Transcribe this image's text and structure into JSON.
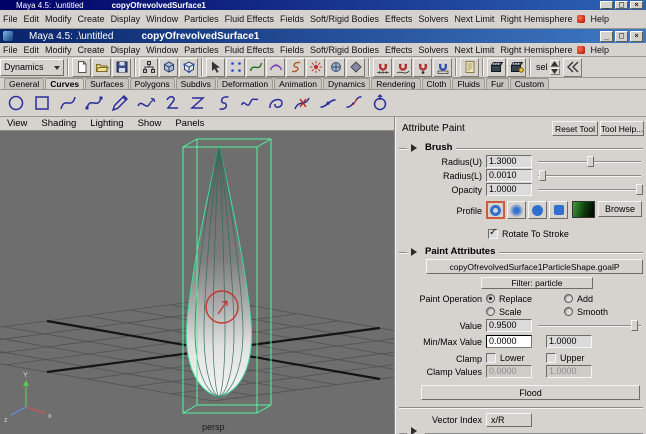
{
  "window": {
    "title": "Maya 4.5: .\\untitled",
    "document": "copyOfrevolvedSurface1"
  },
  "glyphs": {
    "minimize": "_",
    "maximize": "□",
    "close": "×",
    "check": "✓"
  },
  "menus": [
    "File",
    "Edit",
    "Modify",
    "Create",
    "Display",
    "Window",
    "Particles",
    "Fluid Effects",
    "Fields",
    "Soft/Rigid Bodies",
    "Effects",
    "Solvers",
    "Next Limit",
    "Right Hemisphere",
    "Help"
  ],
  "statusline": {
    "menu_set": "Dynamics",
    "quick_select": "sel",
    "icons": [
      "file-new-icon",
      "file-open-icon",
      "file-save-icon",
      "select-hierarchy-icon",
      "select-object-icon",
      "select-component-icon",
      "mask-handles-icon",
      "mask-points-icon",
      "mask-curves-icon",
      "mask-surfaces-icon",
      "mask-deformations-icon",
      "mask-dynamics-icon",
      "mask-rendering-icon",
      "mask-misc-icon",
      "snap-grid-icon",
      "snap-curve-icon",
      "snap-point-icon",
      "snap-plane-icon",
      "history-icon",
      "render-frame-icon",
      "ipr-render-icon",
      "ui-collapse-icon"
    ]
  },
  "shelf": {
    "tabs": [
      "General",
      "Curves",
      "Surfaces",
      "Polygons",
      "Subdivs",
      "Deformation",
      "Animation",
      "Dynamics",
      "Rendering",
      "Cloth",
      "Fluids",
      "Fur",
      "Custom"
    ],
    "active_tab": "Curves",
    "icons": [
      "circle-tool-icon",
      "square-tool-icon",
      "cv-curve-icon",
      "ep-curve-icon",
      "pencil-curve-icon",
      "add-points-icon",
      "curve-fillet-icon",
      "z-curve-icon",
      "s-curve-icon",
      "sine-curve-icon",
      "spiral-curve-icon",
      "cut-curve-icon",
      "attach-curve-icon",
      "detach-curve-icon",
      "close-curve-icon"
    ]
  },
  "panel_menu": [
    "View",
    "Shading",
    "Lighting",
    "Show",
    "Panels"
  ],
  "viewport": {
    "camera": "persp",
    "axis_x": "x",
    "axis_y": "Y",
    "axis_z": "z"
  },
  "tool": {
    "title": "Attribute Paint",
    "reset": "Reset Tool",
    "help": "Tool Help...",
    "brush": {
      "header": "Brush",
      "radius_u_label": "Radius(U)",
      "radius_u": "1.3000",
      "radius_l_label": "Radius(L)",
      "radius_l": "0.0010",
      "opacity_label": "Opacity",
      "opacity": "1.0000",
      "profile_label": "Profile",
      "browse": "Browse",
      "rotate": "Rotate To Stroke"
    },
    "paint": {
      "header": "Paint Attributes",
      "attribute": "copyOfrevolvedSurface1ParticleShape.goalP",
      "filter": "Filter: particle",
      "operation_label": "Paint Operation",
      "op_replace": "Replace",
      "op_scale": "Scale",
      "op_add": "Add",
      "op_smooth": "Smooth",
      "value_label": "Value",
      "value": "0.9500",
      "minmax_label": "Min/Max Value",
      "min": "0.0000",
      "max": "1.0000",
      "clamp_label": "Clamp",
      "lower": "Lower",
      "upper": "Upper",
      "clamp_values_label": "Clamp Values",
      "clamp_min": "0.0000",
      "clamp_max": "1.0000",
      "flood": "Flood",
      "vector_label": "Vector Index",
      "vector": "x/R"
    }
  },
  "colors": {
    "titlebar_blue": "#0a246a",
    "selection_green": "#54f79e",
    "brush_red": "#c5332b",
    "viewport_gray": "#6e6e6e",
    "profile_blue": "#2f6fd0"
  }
}
